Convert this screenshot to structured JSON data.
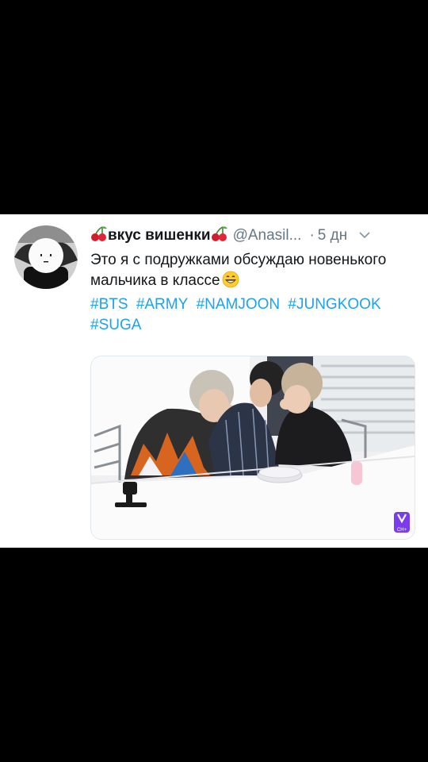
{
  "tweet": {
    "display_name": "вкус вишенки",
    "handle": "@Anasil...",
    "separator": "·",
    "time": "5 дн",
    "text": "Это я с подружками обсуждаю новенького мальчика в классе",
    "hashtags": [
      "#BTS",
      "#ARMY",
      "#NAMJOON",
      "#JUNGKOOK",
      "#SUGA"
    ]
  },
  "media": {
    "watermark_label": "CH+"
  },
  "colors": {
    "link": "#1da1f2",
    "secondary": "#657786",
    "primary_text": "#14171a",
    "background": "#000000"
  },
  "icons": [
    "cherry-emoji-icon",
    "grin-emoji-icon",
    "chevron-down-icon",
    "vlive-logo-icon"
  ]
}
